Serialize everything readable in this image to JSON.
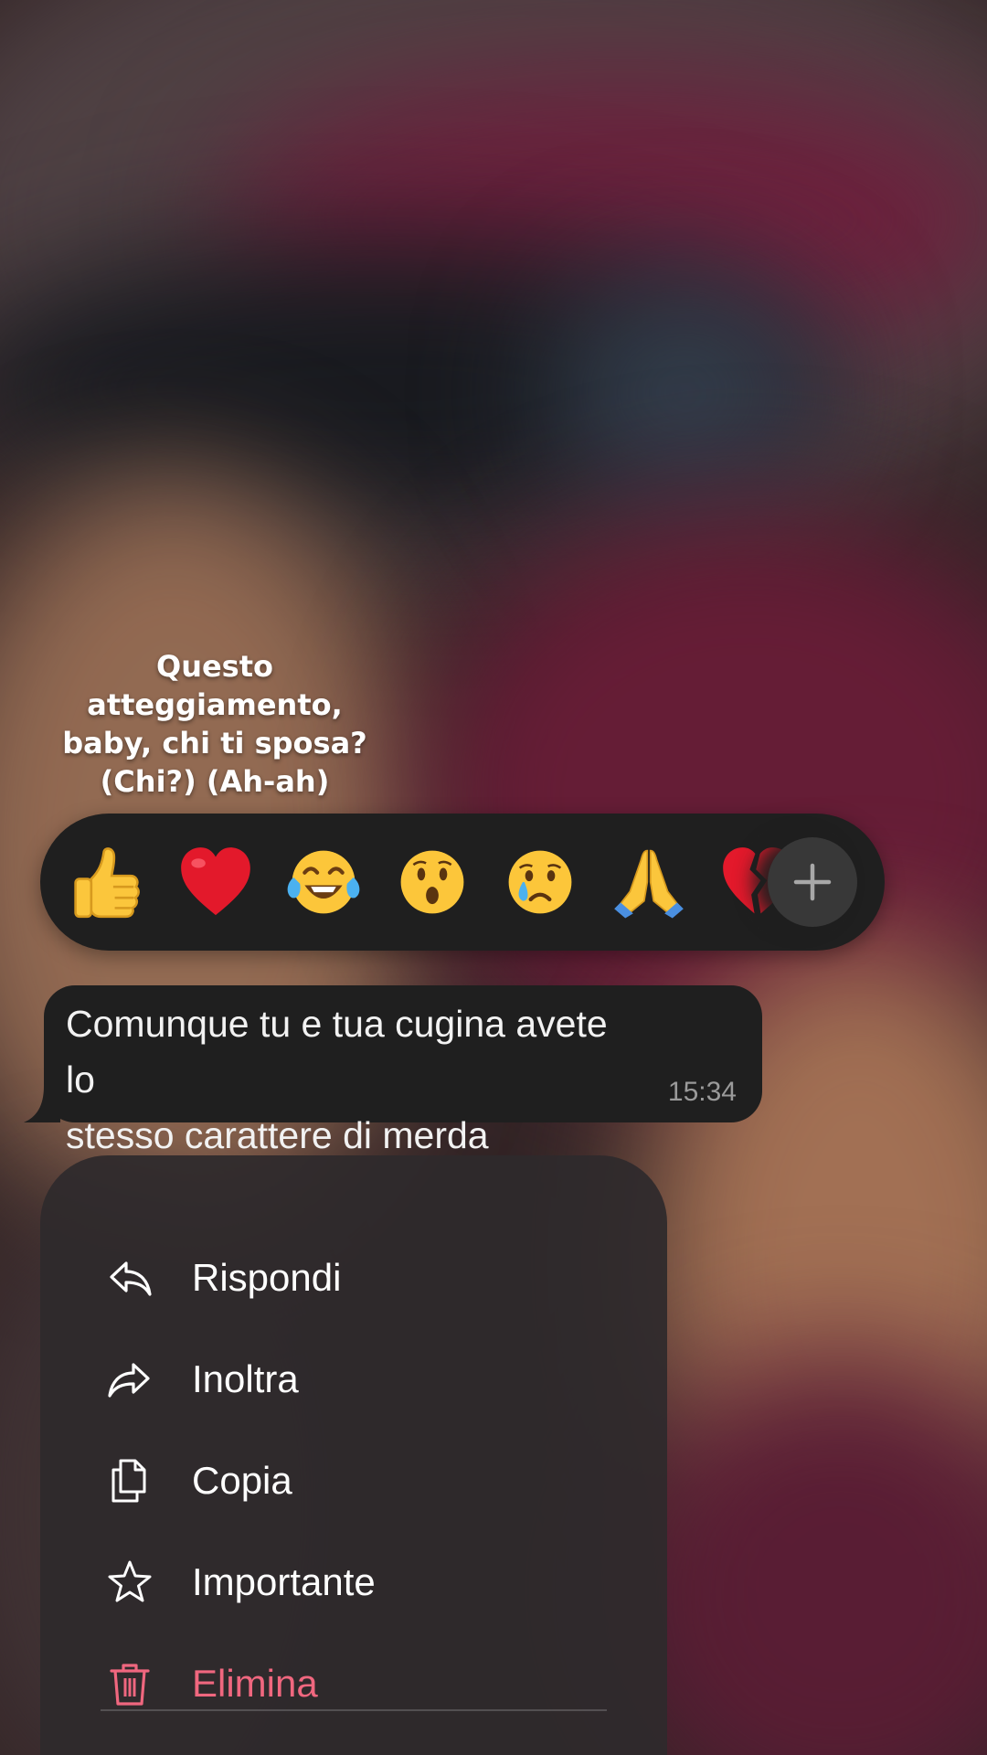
{
  "story": {
    "caption_lines": [
      "Questo",
      "atteggiamento,",
      "baby, chi ti sposa?",
      "(Chi?) (Ah-ah)"
    ]
  },
  "reactions": {
    "emojis": [
      {
        "name": "thumbs-up-icon",
        "glyph": "👍"
      },
      {
        "name": "red-heart-icon",
        "glyph": "❤️"
      },
      {
        "name": "tears-of-joy-icon",
        "glyph": "😂"
      },
      {
        "name": "surprised-face-icon",
        "glyph": "😮"
      },
      {
        "name": "crying-face-icon",
        "glyph": "😢"
      },
      {
        "name": "folded-hands-icon",
        "glyph": "🙏"
      },
      {
        "name": "broken-heart-icon",
        "glyph": "💔"
      }
    ],
    "more_icon": "plus-icon"
  },
  "message": {
    "lines": [
      "Comunque tu e tua cugina avete lo",
      "stesso carattere di merda"
    ],
    "time": "15:34"
  },
  "menu": {
    "items": [
      {
        "label": "Rispondi",
        "icon": "reply-icon"
      },
      {
        "label": "Inoltra",
        "icon": "forward-icon"
      },
      {
        "label": "Copia",
        "icon": "copy-icon"
      },
      {
        "label": "Importante",
        "icon": "star-icon"
      },
      {
        "label": "Elimina",
        "icon": "trash-icon"
      }
    ]
  },
  "colors": {
    "danger": "#f0677f",
    "panel": "#1f1f1f",
    "menu": "#2e2a2c",
    "text": "#ffffff",
    "time": "#9a9a9a"
  }
}
